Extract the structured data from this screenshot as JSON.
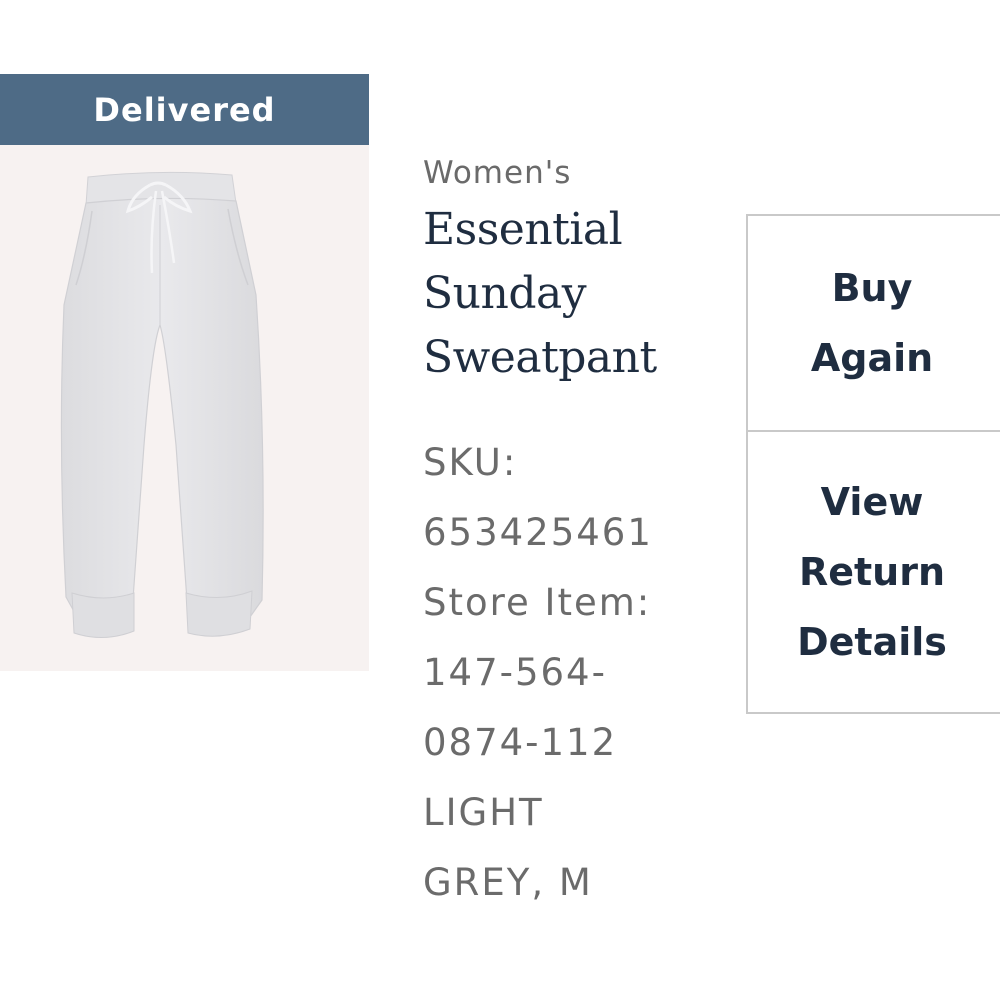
{
  "order_item": {
    "status": "Delivered",
    "image": {
      "icon": "sweatpant-product-photo",
      "background_color": "#f7f2f1",
      "garment_color": "#e6e6e8"
    },
    "category": "Women's",
    "name_lines": [
      "Essential",
      "Sunday",
      "Sweatpant"
    ],
    "sku_label": "SKU:",
    "sku_value": "653425461",
    "store_item_label": "Store Item:",
    "store_item_lines": [
      "147-564-",
      "0874-112"
    ],
    "variant_lines": [
      "LIGHT",
      "GREY, M"
    ]
  },
  "actions": {
    "buy_again_lines": [
      "Buy",
      "Again"
    ],
    "view_return_lines": [
      "View",
      "Return",
      "Details"
    ]
  },
  "colors": {
    "banner": "#4e6b86",
    "text_dark": "#1f2d40",
    "text_muted": "#6b6b6b",
    "border": "#c9c9c9"
  }
}
